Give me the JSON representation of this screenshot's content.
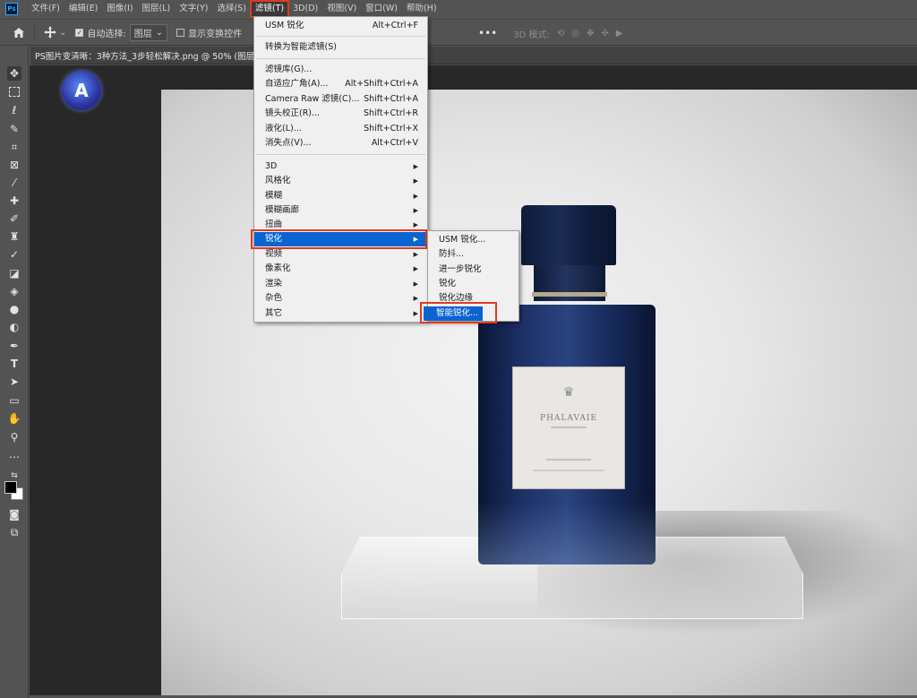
{
  "app": {
    "logo_text": "Ps"
  },
  "menubar": {
    "items": [
      "文件(F)",
      "编辑(E)",
      "图像(I)",
      "图层(L)",
      "文字(Y)",
      "选择(S)",
      "滤镜(T)",
      "3D(D)",
      "视图(V)",
      "窗口(W)",
      "帮助(H)"
    ],
    "active_index": 6
  },
  "options": {
    "auto_select_label": "自动选择:",
    "auto_select_checked": true,
    "auto_select_target": "图层",
    "show_transform_label": "显示变换控件",
    "show_transform_checked": false,
    "more": "•••",
    "mode_3d_label": "3D 模式:"
  },
  "document": {
    "tab_title": "PS图片变清晰：3种方法_3步轻松解决.png @ 50% (图层"
  },
  "filter_menu": {
    "items": [
      {
        "label": "USM 锐化",
        "shortcut": "Alt+Ctrl+F"
      },
      {
        "divider": true
      },
      {
        "label": "转换为智能滤镜(S)",
        "shortcut": ""
      },
      {
        "divider": true
      },
      {
        "label": "滤镜库(G)...",
        "shortcut": ""
      },
      {
        "label": "自适应广角(A)...",
        "shortcut": "Alt+Shift+Ctrl+A"
      },
      {
        "label": "Camera Raw 滤镜(C)...",
        "shortcut": "Shift+Ctrl+A"
      },
      {
        "label": "镜头校正(R)...",
        "shortcut": "Shift+Ctrl+R"
      },
      {
        "label": "液化(L)...",
        "shortcut": "Shift+Ctrl+X"
      },
      {
        "label": "消失点(V)...",
        "shortcut": "Alt+Ctrl+V"
      },
      {
        "divider": true
      },
      {
        "label": "3D",
        "submenu": true
      },
      {
        "label": "风格化",
        "submenu": true
      },
      {
        "label": "模糊",
        "submenu": true
      },
      {
        "label": "模糊画廊",
        "submenu": true
      },
      {
        "label": "扭曲",
        "submenu": true
      },
      {
        "label": "锐化",
        "submenu": true,
        "highlighted": true
      },
      {
        "label": "视频",
        "submenu": true
      },
      {
        "label": "像素化",
        "submenu": true
      },
      {
        "label": "渲染",
        "submenu": true
      },
      {
        "label": "杂色",
        "submenu": true
      },
      {
        "label": "其它",
        "submenu": true
      }
    ]
  },
  "sharpen_submenu": {
    "items": [
      {
        "label": "USM 锐化..."
      },
      {
        "label": "防抖..."
      },
      {
        "label": "进一步锐化"
      },
      {
        "label": "锐化"
      },
      {
        "label": "锐化边缘"
      },
      {
        "label": "智能锐化...",
        "highlighted": true
      }
    ]
  },
  "canvas": {
    "label_brand": "PHALAVAIE",
    "logo_badge_letter": "A"
  },
  "colors": {
    "highlight": "#0a64d2",
    "annotation_red": "#e03a1e",
    "bottle_blue": "#1d3167",
    "ui_gray": "#535353"
  },
  "icons": {
    "toolbar": [
      "move-icon",
      "marquee-icon",
      "lasso-icon",
      "quick-select-icon",
      "crop-icon",
      "frame-icon",
      "eyedropper-icon",
      "healing-brush-icon",
      "brush-icon",
      "clone-stamp-icon",
      "history-brush-icon",
      "eraser-icon",
      "paint-bucket-icon",
      "blur-icon",
      "dodge-icon",
      "pen-icon",
      "type-icon",
      "path-select-icon",
      "shape-icon",
      "hand-icon",
      "zoom-icon",
      "more-tools-icon"
    ]
  }
}
